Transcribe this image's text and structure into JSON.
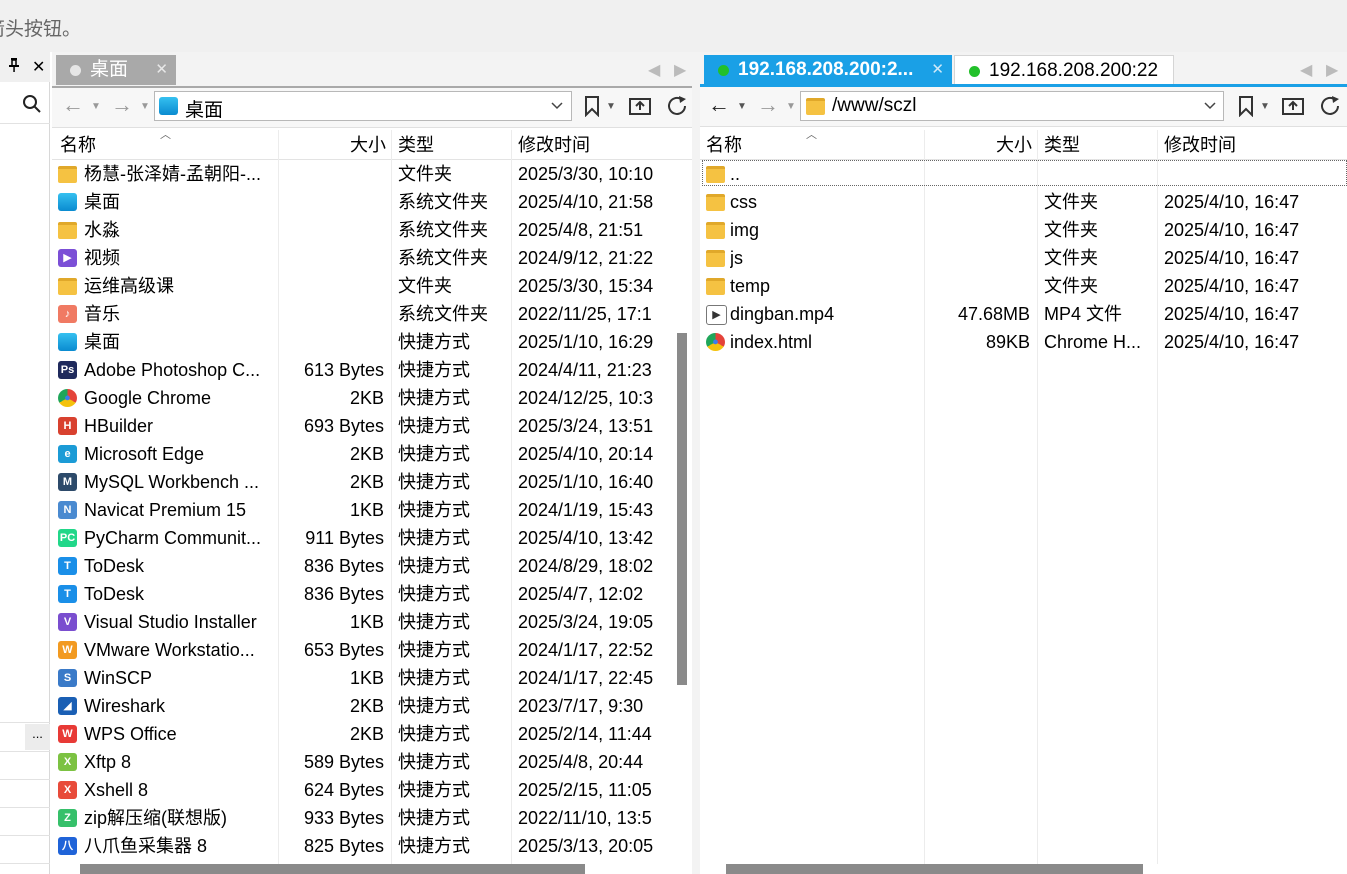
{
  "top_hint": "箭头按钮。",
  "left_strip": {
    "pin": "ꟸ",
    "close": "✕",
    "dots": "..."
  },
  "left_pane": {
    "tab_label": "桌面",
    "path": "桌面",
    "headers": {
      "name": "名称",
      "size": "大小",
      "type": "类型",
      "modified": "修改时间"
    },
    "rows": [
      {
        "name": "杨慧-张泽婧-孟朝阳-...",
        "size": "",
        "type": "文件夹",
        "modified": "2025/3/30, 10:10",
        "icon": "folder",
        "color": "#f5c242"
      },
      {
        "name": "桌面",
        "size": "",
        "type": "系统文件夹",
        "modified": "2025/4/10, 21:58",
        "icon": "desktop",
        "color": "#1ea6e6"
      },
      {
        "name": "水淼",
        "size": "",
        "type": "系统文件夹",
        "modified": "2025/4/8, 21:51",
        "icon": "folder",
        "color": "#f5c242"
      },
      {
        "name": "视频",
        "size": "",
        "type": "系统文件夹",
        "modified": "2024/9/12, 21:22",
        "icon": "video",
        "color": "#7b4fd6"
      },
      {
        "name": "运维高级课",
        "size": "",
        "type": "文件夹",
        "modified": "2025/3/30, 15:34",
        "icon": "folder",
        "color": "#f5c242"
      },
      {
        "name": "音乐",
        "size": "",
        "type": "系统文件夹",
        "modified": "2022/11/25, 17:1",
        "icon": "music",
        "color": "#f07a63"
      },
      {
        "name": "桌面",
        "size": "",
        "type": "快捷方式",
        "modified": "2025/1/10, 16:29",
        "icon": "desktop",
        "color": "#1ea6e6"
      },
      {
        "name": "Adobe Photoshop C...",
        "size": "613 Bytes",
        "type": "快捷方式",
        "modified": "2024/4/11, 21:23",
        "icon": "photoshop",
        "color": "#1f2a5c"
      },
      {
        "name": "Google Chrome",
        "size": "2KB",
        "type": "快捷方式",
        "modified": "2024/12/25, 10:3",
        "icon": "chrome",
        "color": "#e4433a"
      },
      {
        "name": "HBuilder",
        "size": "693 Bytes",
        "type": "快捷方式",
        "modified": "2025/3/24, 13:51",
        "icon": "hbuilder",
        "color": "#d8412f"
      },
      {
        "name": "Microsoft Edge",
        "size": "2KB",
        "type": "快捷方式",
        "modified": "2025/4/10, 20:14",
        "icon": "edge",
        "color": "#1b9bd6"
      },
      {
        "name": "MySQL Workbench ...",
        "size": "2KB",
        "type": "快捷方式",
        "modified": "2025/1/10, 16:40",
        "icon": "mysql",
        "color": "#2d4a6a"
      },
      {
        "name": "Navicat Premium 15",
        "size": "1KB",
        "type": "快捷方式",
        "modified": "2024/1/19, 15:43",
        "icon": "navicat",
        "color": "#4a8ad0"
      },
      {
        "name": "PyCharm Communit...",
        "size": "911 Bytes",
        "type": "快捷方式",
        "modified": "2025/4/10, 13:42",
        "icon": "pycharm",
        "color": "#21d789"
      },
      {
        "name": "ToDesk",
        "size": "836 Bytes",
        "type": "快捷方式",
        "modified": "2024/8/29, 18:02",
        "icon": "todesk",
        "color": "#1a8fe8"
      },
      {
        "name": "ToDesk",
        "size": "836 Bytes",
        "type": "快捷方式",
        "modified": "2025/4/7, 12:02",
        "icon": "todesk",
        "color": "#1a8fe8"
      },
      {
        "name": "Visual Studio Installer",
        "size": "1KB",
        "type": "快捷方式",
        "modified": "2025/3/24, 19:05",
        "icon": "vs",
        "color": "#7a4ecf"
      },
      {
        "name": "VMware Workstatio...",
        "size": "653 Bytes",
        "type": "快捷方式",
        "modified": "2024/1/17, 22:52",
        "icon": "vmware",
        "color": "#f29a21"
      },
      {
        "name": "WinSCP",
        "size": "1KB",
        "type": "快捷方式",
        "modified": "2024/1/17, 22:45",
        "icon": "winscp",
        "color": "#3a7ac8"
      },
      {
        "name": "Wireshark",
        "size": "2KB",
        "type": "快捷方式",
        "modified": "2023/7/17, 9:30",
        "icon": "wireshark",
        "color": "#1a5fb4"
      },
      {
        "name": "WPS Office",
        "size": "2KB",
        "type": "快捷方式",
        "modified": "2025/2/14, 11:44",
        "icon": "wps",
        "color": "#e83a36"
      },
      {
        "name": "Xftp 8",
        "size": "589 Bytes",
        "type": "快捷方式",
        "modified": "2025/4/8, 20:44",
        "icon": "xftp",
        "color": "#7cc242"
      },
      {
        "name": "Xshell 8",
        "size": "624 Bytes",
        "type": "快捷方式",
        "modified": "2025/2/15, 11:05",
        "icon": "xshell",
        "color": "#e84b3a"
      },
      {
        "name": "zip解压缩(联想版)",
        "size": "933 Bytes",
        "type": "快捷方式",
        "modified": "2022/11/10, 13:5",
        "icon": "zip",
        "color": "#36c06a"
      },
      {
        "name": "八爪鱼采集器 8",
        "size": "825 Bytes",
        "type": "快捷方式",
        "modified": "2025/3/13, 20:05",
        "icon": "bazhuayu",
        "color": "#1f63d8"
      }
    ]
  },
  "right_pane": {
    "tabs": [
      {
        "label": "192.168.208.200:2...",
        "active": true,
        "status_color": "#22c02a"
      },
      {
        "label": "192.168.208.200:22",
        "active": false,
        "status_color": "#22c02a"
      }
    ],
    "path": "/www/sczl",
    "headers": {
      "name": "名称",
      "size": "大小",
      "type": "类型",
      "modified": "修改时间"
    },
    "rows": [
      {
        "name": "..",
        "size": "",
        "type": "",
        "modified": "",
        "icon": "folder",
        "color": "#f5c242"
      },
      {
        "name": "css",
        "size": "",
        "type": "文件夹",
        "modified": "2025/4/10, 16:47",
        "icon": "folder",
        "color": "#f5c242"
      },
      {
        "name": "img",
        "size": "",
        "type": "文件夹",
        "modified": "2025/4/10, 16:47",
        "icon": "folder",
        "color": "#f5c242"
      },
      {
        "name": "js",
        "size": "",
        "type": "文件夹",
        "modified": "2025/4/10, 16:47",
        "icon": "folder",
        "color": "#f5c242"
      },
      {
        "name": "temp",
        "size": "",
        "type": "文件夹",
        "modified": "2025/4/10, 16:47",
        "icon": "folder",
        "color": "#f5c242"
      },
      {
        "name": "dingban.mp4",
        "size": "47.68MB",
        "type": "MP4 文件",
        "modified": "2025/4/10, 16:47",
        "icon": "video-file",
        "color": "#333333"
      },
      {
        "name": "index.html",
        "size": "89KB",
        "type": "Chrome H...",
        "modified": "2025/4/10, 16:47",
        "icon": "chrome",
        "color": "#e4433a"
      }
    ]
  },
  "accent_color": "#1aa0e6"
}
